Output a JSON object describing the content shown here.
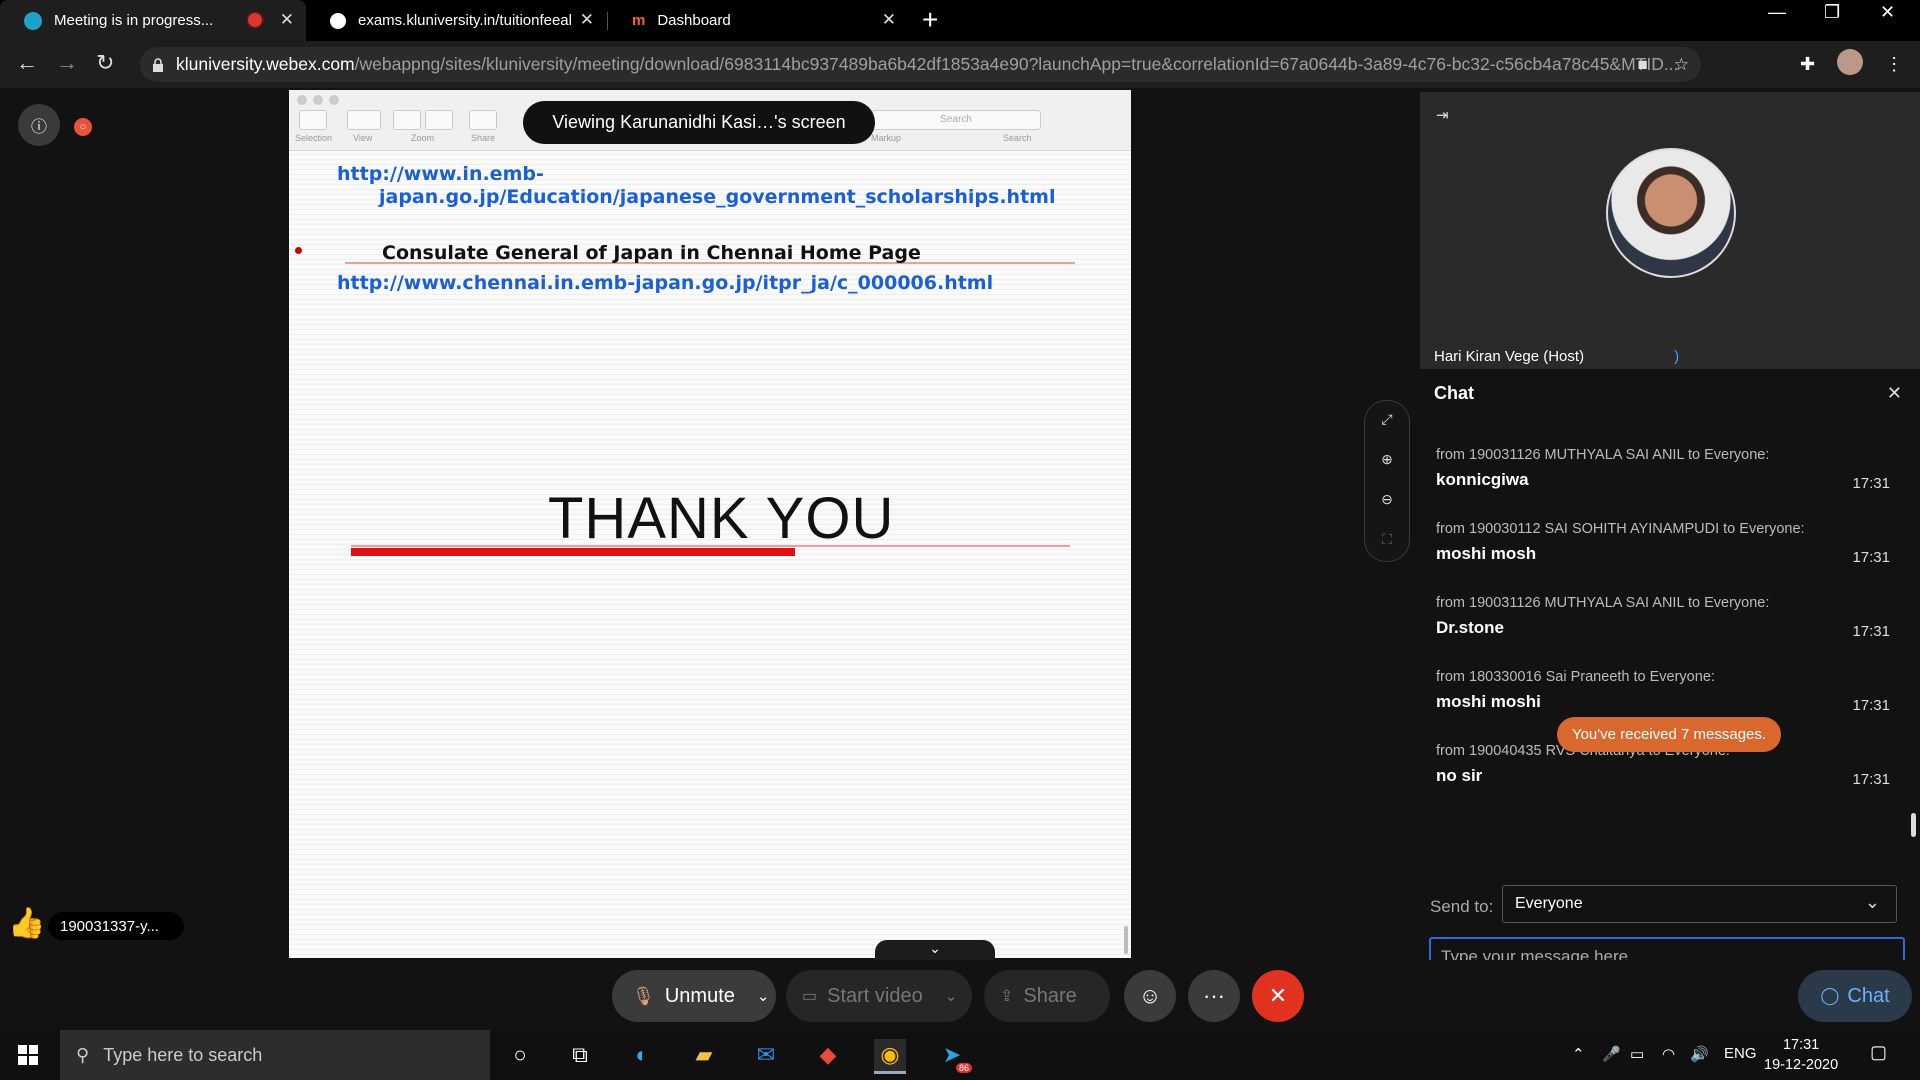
{
  "browser": {
    "tabs": [
      {
        "title": "Meeting is in progress...",
        "active": true
      },
      {
        "title": "exams.kluniversity.in/tuitionfeeal",
        "active": false
      },
      {
        "title": "Dashboard",
        "active": false
      }
    ],
    "url_host": "kluniversity.webex.com",
    "url_path": "/webappng/sites/kluniversity/meeting/download/6983114bc937489ba6b42df1853a4e90?launchApp=true&correlationId=67a0644b-3a89-4c76-bc32-c56cb4a78c45&MTID..."
  },
  "share": {
    "viewing_label": "Viewing Karunanidhi Kasi…'s screen",
    "toolbar_labels": [
      "Selection",
      "View",
      "Zoom",
      "Share",
      "Markup",
      "Search"
    ],
    "search_placeholder": "Search",
    "slide": {
      "link1_line1": "http://www.in.emb-",
      "link1_line2": "japan.go.jp/Education/japanese_government_scholarships.html",
      "heading": "Consulate General of Japan in Chennai Home Page",
      "link2": "http://www.chennai.in.emb-japan.go.jp/itpr_ja/c_000006.html",
      "thank_you": "THANK YOU"
    }
  },
  "reaction": {
    "icon": "thumbs-up-icon",
    "name": "190031337-y..."
  },
  "host": {
    "name": "Hari Kiran Vege (Host)"
  },
  "chat": {
    "title": "Chat",
    "messages": [
      {
        "from": "from 190031126 MUTHYALA SAI ANIL to Everyone:",
        "body": "konnicgiwa",
        "time": "17:31"
      },
      {
        "from": "from 190030112 SAI SOHITH AYINAMPUDI to Everyone:",
        "body": "moshi mosh",
        "time": "17:31"
      },
      {
        "from": "from 190031126 MUTHYALA SAI ANIL to Everyone:",
        "body": "Dr.stone",
        "time": "17:31"
      },
      {
        "from": "from 180330016 Sai Praneeth to Everyone:",
        "body": "moshi moshi",
        "time": "17:31"
      },
      {
        "from": "from 190040435 RVS Chaitanya to Everyone:",
        "body": "no sir",
        "time": "17:31"
      }
    ],
    "new_messages": "You've received 7 messages.",
    "send_to_label": "Send to:",
    "send_to_value": "Everyone",
    "input_placeholder": "Type your message here"
  },
  "controls": {
    "unmute": "Unmute",
    "start_video": "Start video",
    "share": "Share",
    "chat": "Chat"
  },
  "taskbar": {
    "search_placeholder": "Type here to search",
    "language": "ENG",
    "time": "17:31",
    "date": "19-12-2020",
    "telegram_badge": "86"
  },
  "colors": {
    "accent_blue": "#2c6bd8",
    "leave_red": "#e0321f",
    "notice_orange": "#d9682f",
    "link_blue": "#1a5fd6"
  }
}
